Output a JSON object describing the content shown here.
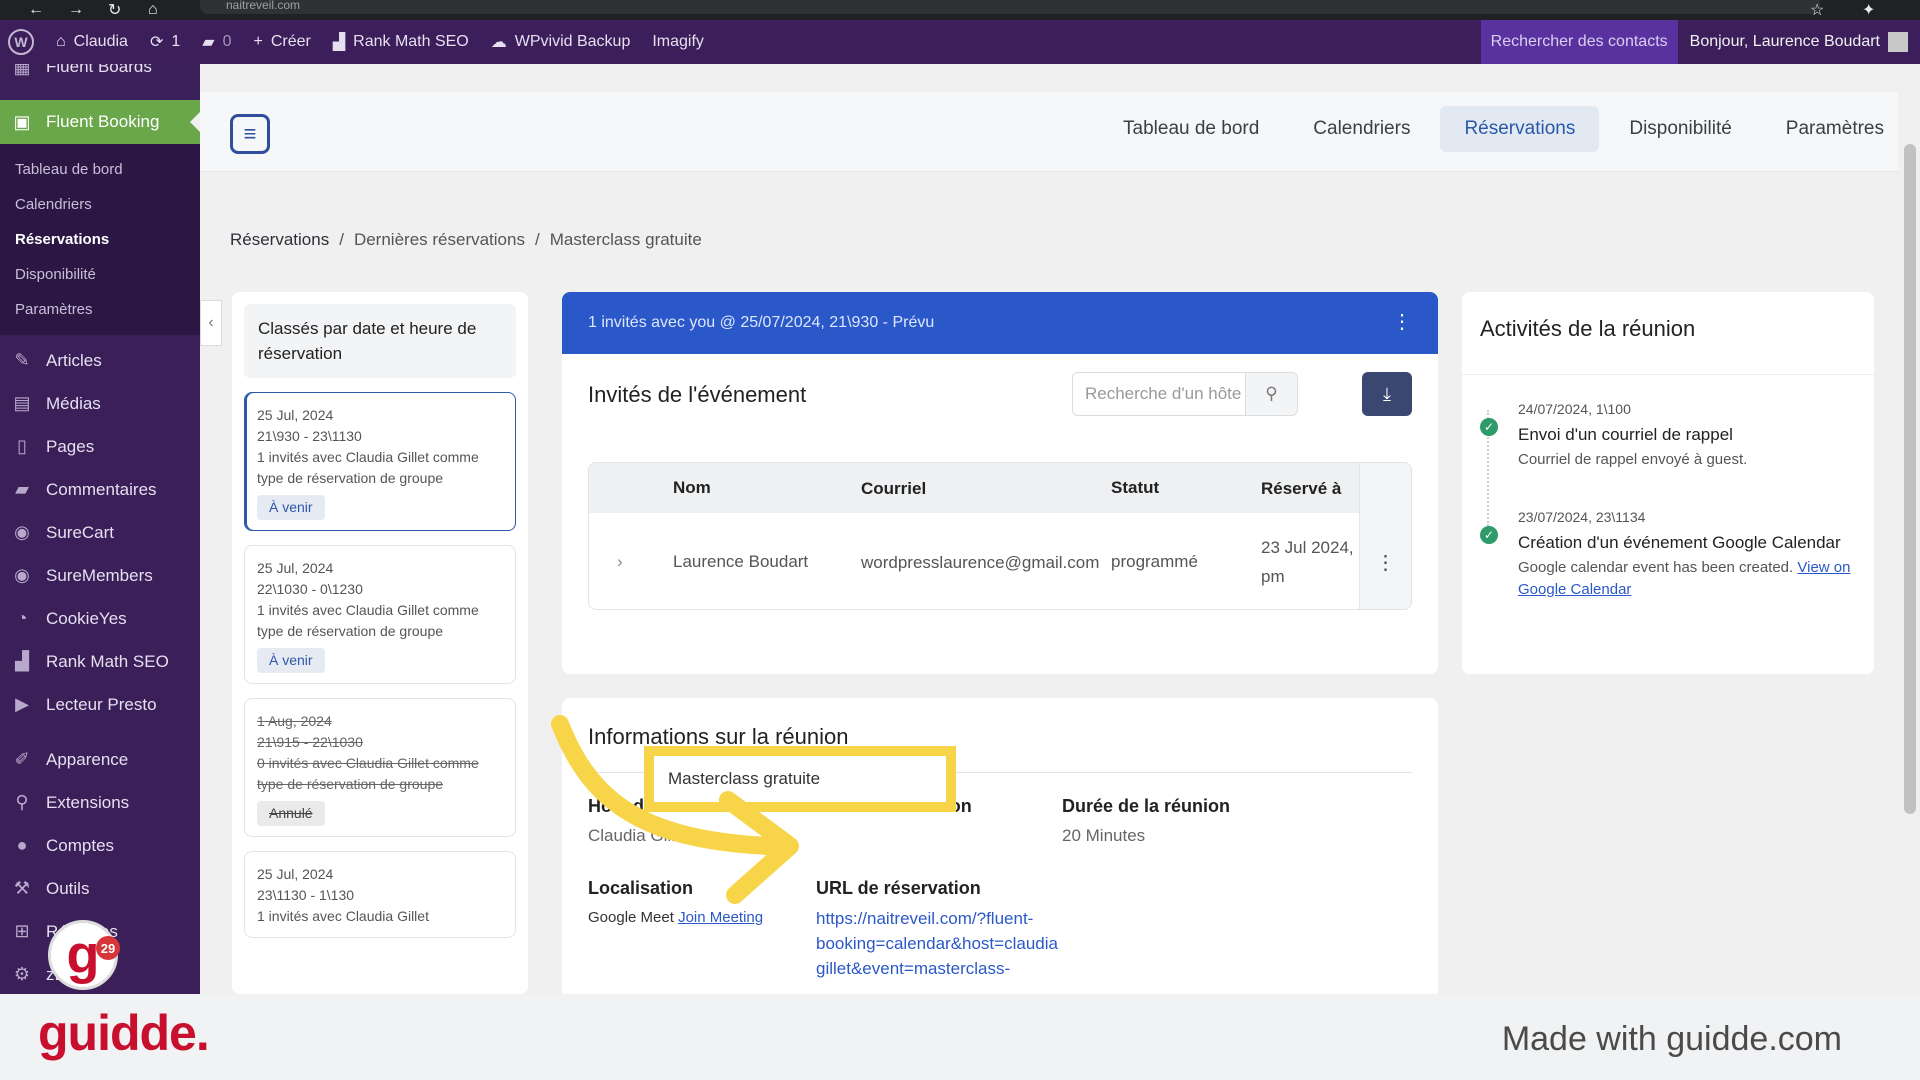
{
  "browser": {
    "url": "naitreveil.com"
  },
  "adminbar": {
    "site": "Claudia",
    "updates": "1",
    "comments": "0",
    "create": "Créer",
    "rankmath": "Rank Math SEO",
    "wpvivid": "WPvivid Backup",
    "imagify": "Imagify",
    "contacts": "Rechercher des contacts",
    "howdy": "Bonjour, Laurence Boudart"
  },
  "sidebar": {
    "above": "Fluent Boards",
    "active": "Fluent Booking",
    "sub": [
      "Tableau de bord",
      "Calendriers",
      "Réservations",
      "Disponibilité",
      "Paramètres"
    ],
    "menu": [
      "Articles",
      "Médias",
      "Pages",
      "Commentaires",
      "SureCart",
      "SureMembers",
      "CookieYes",
      "Rank Math SEO",
      "Lecteur Presto",
      "Apparence",
      "Extensions",
      "Comptes",
      "Outils",
      "Réglages",
      "zBuilder"
    ]
  },
  "app": {
    "tabs": [
      "Tableau de bord",
      "Calendriers",
      "Réservations",
      "Disponibilité",
      "Paramètres"
    ],
    "active_tab": "Réservations"
  },
  "breadcrumb": [
    "Réservations",
    "Dernières réservations",
    "Masterclass gratuite"
  ],
  "list": {
    "heading": "Classés par date et heure de réservation",
    "cards": [
      {
        "date": "25 Jul, 2024",
        "time": "21\\930 - 23\\1130",
        "desc": "1 invités avec Claudia Gillet comme type de réservation de groupe",
        "badge": "À venir"
      },
      {
        "date": "25 Jul, 2024",
        "time": "22\\1030 - 0\\1230",
        "desc": "1 invités avec Claudia Gillet comme type de réservation de groupe",
        "badge": "À venir"
      },
      {
        "date": "1 Aug, 2024",
        "time": "21\\915 - 22\\1030",
        "desc": "0 invités avec Claudia Gillet comme type de réservation de groupe",
        "badge": "Annulé"
      },
      {
        "date": "25 Jul, 2024",
        "time": "23\\1130 - 1\\130",
        "desc": "1 invités avec Claudia Gillet"
      }
    ]
  },
  "detail": {
    "banner": "1 invités avec you @ 25/07/2024, 21\\930 - Prévu",
    "guests_title": "Invités de l'événement",
    "search_placeholder": "Recherche d'un hôte",
    "columns": [
      "Nom",
      "Courriel",
      "Statut",
      "Réservé à"
    ],
    "rows": [
      {
        "name": "Laurence Boudart",
        "email": "wordpresslaurence@gmail.com",
        "status": "programmé",
        "booked": "23 Jul 2024, 1",
        "booked2": "pm"
      }
    ]
  },
  "info": {
    "title": "Informations sur la réunion",
    "host_label": "Hôte de la réunion",
    "host_value": "Claudia Gillet",
    "meeting_title_label": "Titre de la réunion",
    "meeting_title_value": "Masterclass gratuite",
    "duration_label": "Durée de la réunion",
    "duration_value": "20 Minutes",
    "location_label": "Localisation",
    "location_value": "Google Meet",
    "location_link": "Join Meeting",
    "url_label": "URL de réservation",
    "url_value": "https://naitreveil.com/?fluent-booking=calendar&host=claudia gillet&event=masterclass-"
  },
  "activity": {
    "title": "Activités de la réunion",
    "items": [
      {
        "ts": "24/07/2024, 1\\100",
        "title": "Envoi d'un courriel de rappel",
        "desc": "Courriel de rappel envoyé à guest."
      },
      {
        "ts": "23/07/2024, 23\\1134",
        "title": "Création d'un événement Google Calendar",
        "desc": "Google calendar event has been created.",
        "link": "View on Google Calendar"
      }
    ]
  },
  "overlay": {
    "badge_count": "29",
    "arrow_color": "#f7d448",
    "highlight_color": "#f7d448"
  },
  "footer": {
    "brand": "guidde.",
    "made_with": "Made with guidde.com"
  }
}
